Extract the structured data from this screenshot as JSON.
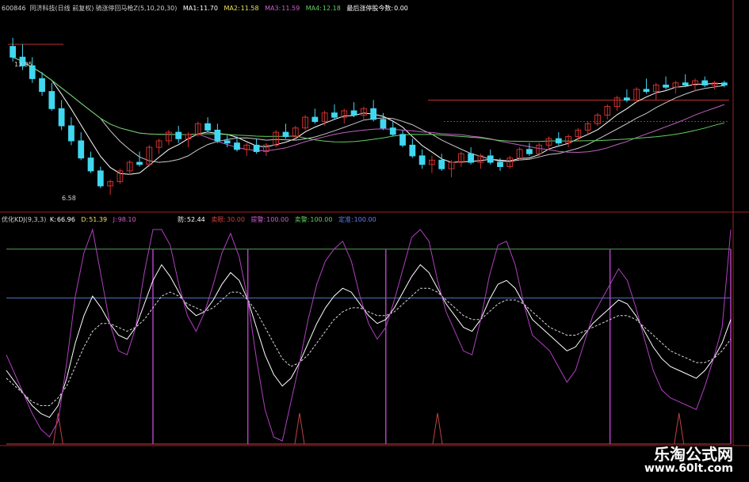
{
  "header_top": {
    "code": "600846",
    "name": "同济科技(日线 前复权)",
    "indicator": "骑涨停回马枪Z(5,10,20,30)",
    "ma1_label": "MA1:",
    "ma1": "11.70",
    "ma2_label": "MA2:",
    "ma2": "11.58",
    "ma3_label": "MA3:",
    "ma3": "11.59",
    "ma4_label": "MA4:",
    "ma4": "12.18",
    "extra_label": "最后涨停股今数:",
    "extra": "0.00"
  },
  "header_bottom": {
    "name": "优化KDJ(9,3,3)",
    "k_label": "K:",
    "k": "66.96",
    "d_label": "D:",
    "d": "51.39",
    "j_label": "J:",
    "j": "98.10",
    "fang_label": "防:",
    "fang": "52.44",
    "sell_label": "卖眼:",
    "sell": "30.00",
    "warn_label": "提警:",
    "warn": "100.00",
    "buy_label": "卖警:",
    "buy": "100.00",
    "fixed_label": "定准:",
    "fixed": "100.00"
  },
  "price_labels": {
    "high": "13.95",
    "low": "6.58"
  },
  "watermark": {
    "title": "乐淘公式网",
    "url": "www.60lt.com"
  },
  "colors": {
    "up": "#d03030",
    "down": "#40d8f0",
    "ma1": "#ffffff",
    "ma2": "#c8c8c8",
    "ma3": "#c060c0",
    "ma4": "#60d060",
    "k": "#ffffff",
    "d": "#d8d8d8",
    "j": "#b040c0",
    "band_top": "#50a050",
    "band_mid": "#5070c0",
    "spike": "#c04040"
  },
  "chart_data": [
    {
      "type": "candlestick",
      "title": "骑涨停回马枪Z(5,10,20,30)",
      "ylim": [
        6,
        15
      ],
      "candles": [
        {
          "o": 13.5,
          "h": 13.9,
          "l": 12.8,
          "c": 13.0
        },
        {
          "o": 13.0,
          "h": 13.6,
          "l": 12.4,
          "c": 12.6
        },
        {
          "o": 12.6,
          "h": 13.0,
          "l": 11.8,
          "c": 12.0
        },
        {
          "o": 12.0,
          "h": 12.3,
          "l": 11.2,
          "c": 11.4
        },
        {
          "o": 11.4,
          "h": 11.8,
          "l": 10.5,
          "c": 10.6
        },
        {
          "o": 10.6,
          "h": 11.0,
          "l": 9.6,
          "c": 9.8
        },
        {
          "o": 9.8,
          "h": 10.2,
          "l": 8.9,
          "c": 9.1
        },
        {
          "o": 9.1,
          "h": 9.5,
          "l": 8.2,
          "c": 8.3
        },
        {
          "o": 8.3,
          "h": 8.6,
          "l": 7.6,
          "c": 7.7
        },
        {
          "o": 7.7,
          "h": 7.9,
          "l": 6.9,
          "c": 7.0
        },
        {
          "o": 7.0,
          "h": 7.3,
          "l": 6.58,
          "c": 7.2
        },
        {
          "o": 7.2,
          "h": 7.8,
          "l": 7.1,
          "c": 7.7
        },
        {
          "o": 7.7,
          "h": 8.2,
          "l": 7.5,
          "c": 8.1
        },
        {
          "o": 8.1,
          "h": 8.6,
          "l": 7.9,
          "c": 8.0
        },
        {
          "o": 8.0,
          "h": 8.9,
          "l": 7.9,
          "c": 8.8
        },
        {
          "o": 8.8,
          "h": 9.2,
          "l": 8.5,
          "c": 9.1
        },
        {
          "o": 9.1,
          "h": 9.6,
          "l": 8.9,
          "c": 9.5
        },
        {
          "o": 9.5,
          "h": 9.8,
          "l": 9.0,
          "c": 9.2
        },
        {
          "o": 9.2,
          "h": 9.5,
          "l": 8.8,
          "c": 9.4
        },
        {
          "o": 9.4,
          "h": 10.0,
          "l": 9.3,
          "c": 9.9
        },
        {
          "o": 9.9,
          "h": 10.2,
          "l": 9.5,
          "c": 9.6
        },
        {
          "o": 9.6,
          "h": 9.9,
          "l": 9.0,
          "c": 9.1
        },
        {
          "o": 9.1,
          "h": 9.4,
          "l": 8.8,
          "c": 9.0
        },
        {
          "o": 9.0,
          "h": 9.3,
          "l": 8.6,
          "c": 8.7
        },
        {
          "o": 8.7,
          "h": 9.0,
          "l": 8.4,
          "c": 8.9
        },
        {
          "o": 8.9,
          "h": 9.2,
          "l": 8.5,
          "c": 8.6
        },
        {
          "o": 8.6,
          "h": 9.0,
          "l": 8.4,
          "c": 8.9
        },
        {
          "o": 8.9,
          "h": 9.6,
          "l": 8.8,
          "c": 9.5
        },
        {
          "o": 9.5,
          "h": 9.9,
          "l": 9.2,
          "c": 9.3
        },
        {
          "o": 9.3,
          "h": 9.8,
          "l": 9.2,
          "c": 9.7
        },
        {
          "o": 9.7,
          "h": 10.3,
          "l": 9.6,
          "c": 10.2
        },
        {
          "o": 10.2,
          "h": 10.6,
          "l": 9.9,
          "c": 10.0
        },
        {
          "o": 10.0,
          "h": 10.5,
          "l": 9.8,
          "c": 10.4
        },
        {
          "o": 10.4,
          "h": 10.8,
          "l": 10.1,
          "c": 10.2
        },
        {
          "o": 10.2,
          "h": 10.6,
          "l": 9.9,
          "c": 10.5
        },
        {
          "o": 10.5,
          "h": 10.9,
          "l": 10.2,
          "c": 10.3
        },
        {
          "o": 10.3,
          "h": 10.7,
          "l": 10.1,
          "c": 10.6
        },
        {
          "o": 10.6,
          "h": 11.0,
          "l": 10.0,
          "c": 10.1
        },
        {
          "o": 10.1,
          "h": 10.4,
          "l": 9.6,
          "c": 9.7
        },
        {
          "o": 9.7,
          "h": 10.0,
          "l": 9.3,
          "c": 9.4
        },
        {
          "o": 9.4,
          "h": 9.6,
          "l": 8.8,
          "c": 8.9
        },
        {
          "o": 8.9,
          "h": 9.2,
          "l": 8.3,
          "c": 8.4
        },
        {
          "o": 8.4,
          "h": 8.7,
          "l": 7.8,
          "c": 8.0
        },
        {
          "o": 8.0,
          "h": 8.4,
          "l": 7.6,
          "c": 8.2
        },
        {
          "o": 8.2,
          "h": 8.5,
          "l": 7.7,
          "c": 7.8
        },
        {
          "o": 7.8,
          "h": 8.2,
          "l": 7.4,
          "c": 8.1
        },
        {
          "o": 8.1,
          "h": 8.6,
          "l": 7.9,
          "c": 8.5
        },
        {
          "o": 8.5,
          "h": 8.8,
          "l": 8.0,
          "c": 8.1
        },
        {
          "o": 8.1,
          "h": 8.5,
          "l": 7.8,
          "c": 8.4
        },
        {
          "o": 8.4,
          "h": 8.7,
          "l": 8.0,
          "c": 8.1
        },
        {
          "o": 8.1,
          "h": 8.3,
          "l": 7.7,
          "c": 7.9
        },
        {
          "o": 7.9,
          "h": 8.4,
          "l": 7.8,
          "c": 8.3
        },
        {
          "o": 8.3,
          "h": 8.8,
          "l": 8.2,
          "c": 8.7
        },
        {
          "o": 8.7,
          "h": 9.0,
          "l": 8.4,
          "c": 8.5
        },
        {
          "o": 8.5,
          "h": 9.0,
          "l": 8.4,
          "c": 8.9
        },
        {
          "o": 8.9,
          "h": 9.3,
          "l": 8.7,
          "c": 9.2
        },
        {
          "o": 9.2,
          "h": 9.5,
          "l": 8.9,
          "c": 9.0
        },
        {
          "o": 9.0,
          "h": 9.4,
          "l": 8.8,
          "c": 9.3
        },
        {
          "o": 9.3,
          "h": 9.7,
          "l": 9.1,
          "c": 9.6
        },
        {
          "o": 9.6,
          "h": 10.0,
          "l": 9.4,
          "c": 9.9
        },
        {
          "o": 9.9,
          "h": 10.4,
          "l": 9.8,
          "c": 10.3
        },
        {
          "o": 10.3,
          "h": 10.8,
          "l": 10.1,
          "c": 10.7
        },
        {
          "o": 10.7,
          "h": 11.2,
          "l": 10.5,
          "c": 11.1
        },
        {
          "o": 11.1,
          "h": 11.5,
          "l": 10.9,
          "c": 11.0
        },
        {
          "o": 11.0,
          "h": 11.6,
          "l": 10.9,
          "c": 11.5
        },
        {
          "o": 11.5,
          "h": 12.0,
          "l": 11.3,
          "c": 11.4
        },
        {
          "o": 11.4,
          "h": 11.8,
          "l": 11.0,
          "c": 11.7
        },
        {
          "o": 11.7,
          "h": 12.1,
          "l": 11.5,
          "c": 11.6
        },
        {
          "o": 11.6,
          "h": 11.9,
          "l": 11.3,
          "c": 11.8
        },
        {
          "o": 11.8,
          "h": 12.2,
          "l": 11.6,
          "c": 11.7
        },
        {
          "o": 11.7,
          "h": 12.0,
          "l": 11.4,
          "c": 11.9
        },
        {
          "o": 11.9,
          "h": 12.1,
          "l": 11.6,
          "c": 11.7
        },
        {
          "o": 11.7,
          "h": 11.9,
          "l": 11.5,
          "c": 11.8
        },
        {
          "o": 11.8,
          "h": 11.9,
          "l": 11.6,
          "c": 11.7
        }
      ]
    },
    {
      "type": "line",
      "title": "优化KDJ(9,3,3)",
      "ylim": [
        0,
        110
      ],
      "series": [
        {
          "name": "K",
          "values": [
            38,
            32,
            26,
            20,
            16,
            14,
            20,
            34,
            52,
            66,
            76,
            70,
            62,
            56,
            54,
            60,
            72,
            84,
            92,
            86,
            78,
            70,
            66,
            68,
            74,
            82,
            88,
            84,
            74,
            60,
            46,
            36,
            30,
            34,
            42,
            52,
            62,
            70,
            76,
            80,
            78,
            72,
            66,
            62,
            64,
            70,
            78,
            86,
            92,
            88,
            80,
            72,
            66,
            60,
            58,
            64,
            74,
            82,
            84,
            80,
            72,
            64,
            60,
            56,
            52,
            48,
            50,
            56,
            62,
            66,
            70,
            74,
            72,
            66,
            58,
            50,
            44,
            40,
            38,
            36,
            34,
            38,
            44,
            52,
            64
          ]
        },
        {
          "name": "D",
          "values": [
            34,
            30,
            26,
            22,
            20,
            20,
            24,
            30,
            40,
            50,
            58,
            62,
            62,
            60,
            58,
            60,
            64,
            70,
            76,
            78,
            76,
            72,
            70,
            68,
            70,
            74,
            78,
            78,
            74,
            68,
            60,
            52,
            44,
            40,
            42,
            46,
            52,
            58,
            64,
            68,
            70,
            70,
            68,
            66,
            66,
            68,
            72,
            76,
            80,
            80,
            78,
            74,
            70,
            66,
            64,
            64,
            68,
            72,
            74,
            74,
            72,
            68,
            64,
            60,
            58,
            56,
            56,
            58,
            60,
            62,
            64,
            66,
            66,
            64,
            60,
            56,
            52,
            48,
            46,
            44,
            42,
            42,
            44,
            48,
            54
          ]
        },
        {
          "name": "J",
          "values": [
            46,
            36,
            26,
            16,
            8,
            4,
            12,
            42,
            76,
            98,
            110,
            86,
            62,
            48,
            46,
            60,
            88,
            110,
            110,
            102,
            82,
            66,
            58,
            68,
            82,
            98,
            108,
            96,
            74,
            44,
            18,
            4,
            2,
            22,
            42,
            64,
            82,
            94,
            100,
            104,
            94,
            76,
            62,
            54,
            60,
            74,
            90,
            106,
            110,
            104,
            84,
            68,
            58,
            48,
            46,
            64,
            86,
            102,
            104,
            92,
            72,
            56,
            52,
            48,
            40,
            32,
            38,
            52,
            66,
            74,
            82,
            90,
            84,
            70,
            54,
            38,
            28,
            24,
            22,
            20,
            18,
            30,
            44,
            60,
            110
          ]
        }
      ]
    }
  ]
}
